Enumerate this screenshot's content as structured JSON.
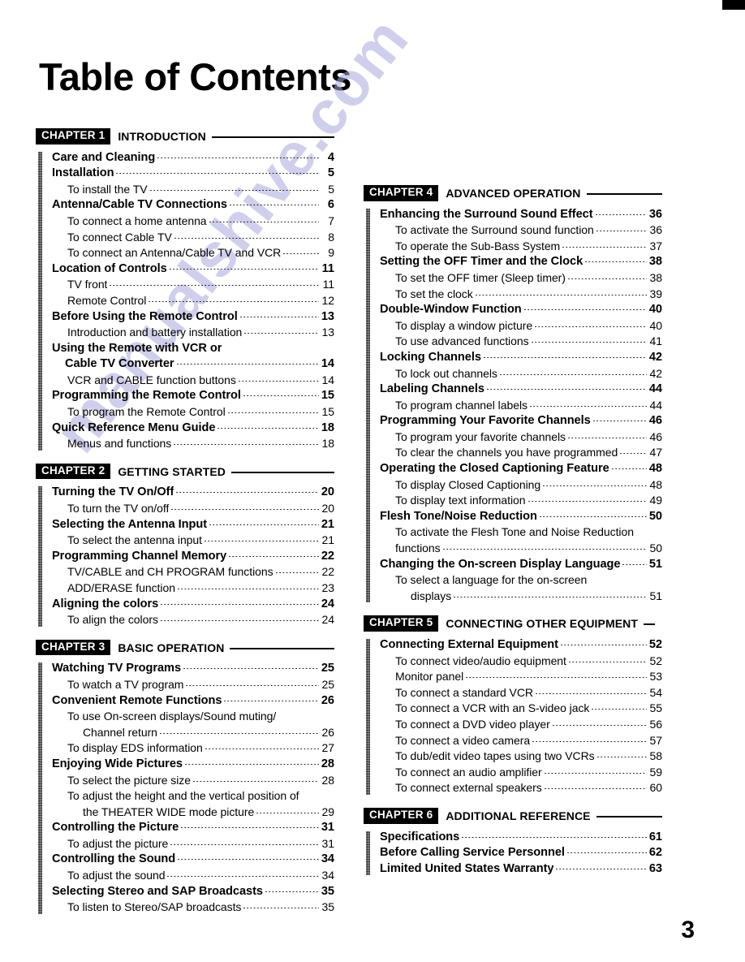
{
  "page": {
    "title": "Table of Contents",
    "folio": "3",
    "watermark": "manualshive.com",
    "accent_color": "#000000",
    "watermark_color": "#a9a8e0"
  },
  "columns": {
    "left": [
      {
        "tag": "CHAPTER 1",
        "name": "INTRODUCTION",
        "rule": "long",
        "entries": [
          {
            "level": 1,
            "label": "Care and Cleaning",
            "page": "4"
          },
          {
            "level": 1,
            "label": "Installation",
            "page": "5"
          },
          {
            "level": 2,
            "label": "To install the TV",
            "page": "5"
          },
          {
            "level": 1,
            "label": "Antenna/Cable TV Connections",
            "page": "6"
          },
          {
            "level": 2,
            "label": "To connect a home antenna",
            "page": "7"
          },
          {
            "level": 2,
            "label": "To connect Cable TV",
            "page": "8"
          },
          {
            "level": 2,
            "label": "To connect an Antenna/Cable TV and VCR",
            "page": "9"
          },
          {
            "level": 1,
            "label": "Location of Controls",
            "page": "11"
          },
          {
            "level": 2,
            "label": "TV front",
            "page": "11"
          },
          {
            "level": 2,
            "label": "Remote Control",
            "page": "12"
          },
          {
            "level": 1,
            "label": "Before Using the Remote Control",
            "page": "13"
          },
          {
            "level": 2,
            "label": "Introduction and battery installation",
            "page": "13"
          },
          {
            "level": 1,
            "label": "Using the Remote with VCR or",
            "page": "",
            "leader": false
          },
          {
            "level": 1,
            "label": "Cable TV Converter",
            "page": "14",
            "continued": true
          },
          {
            "level": 2,
            "label": "VCR and CABLE function buttons",
            "page": "14"
          },
          {
            "level": 1,
            "label": "Programming the Remote Control",
            "page": "15"
          },
          {
            "level": 2,
            "label": "To program the Remote Control",
            "page": "15"
          },
          {
            "level": 1,
            "label": "Quick Reference Menu Guide",
            "page": "18"
          },
          {
            "level": 2,
            "label": "Menus and functions",
            "page": "18"
          }
        ]
      },
      {
        "tag": "CHAPTER 2",
        "name": "GETTING STARTED",
        "rule": "long",
        "entries": [
          {
            "level": 1,
            "label": "Turning the TV On/Off",
            "page": "20"
          },
          {
            "level": 2,
            "label": "To turn the TV on/off",
            "page": "20"
          },
          {
            "level": 1,
            "label": "Selecting the Antenna Input",
            "page": "21"
          },
          {
            "level": 2,
            "label": "To select the antenna input",
            "page": "21"
          },
          {
            "level": 1,
            "label": "Programming Channel Memory",
            "page": "22"
          },
          {
            "level": 2,
            "label": "TV/CABLE and CH PROGRAM functions",
            "page": "22"
          },
          {
            "level": 2,
            "label": "ADD/ERASE function",
            "page": "23"
          },
          {
            "level": 1,
            "label": "Aligning the colors",
            "page": "24"
          },
          {
            "level": 2,
            "label": "To align the colors",
            "page": "24"
          }
        ]
      },
      {
        "tag": "CHAPTER 3",
        "name": "BASIC OPERATION",
        "rule": "long",
        "entries": [
          {
            "level": 1,
            "label": "Watching TV Programs",
            "page": "25"
          },
          {
            "level": 2,
            "label": "To watch a TV program",
            "page": "25"
          },
          {
            "level": 1,
            "label": "Convenient Remote Functions",
            "page": "26"
          },
          {
            "level": 2,
            "label": "To use On-screen displays/Sound muting/",
            "page": "",
            "leader": false
          },
          {
            "level": 2,
            "label": "Channel return",
            "page": "26",
            "continued": true
          },
          {
            "level": 2,
            "label": "To display EDS information",
            "page": "27"
          },
          {
            "level": 1,
            "label": "Enjoying Wide Pictures",
            "page": "28"
          },
          {
            "level": 2,
            "label": "To select the picture size",
            "page": "28"
          },
          {
            "level": 2,
            "label": "To adjust the height and the vertical position of",
            "page": "",
            "leader": false
          },
          {
            "level": 2,
            "label": "the THEATER WIDE mode picture",
            "page": "29",
            "continued": true
          },
          {
            "level": 1,
            "label": "Controlling the Picture",
            "page": "31"
          },
          {
            "level": 2,
            "label": "To adjust the picture",
            "page": "31"
          },
          {
            "level": 1,
            "label": "Controlling the Sound",
            "page": "34"
          },
          {
            "level": 2,
            "label": "To adjust the sound",
            "page": "34"
          },
          {
            "level": 1,
            "label": "Selecting Stereo and SAP Broadcasts",
            "page": "35"
          },
          {
            "level": 2,
            "label": "To listen to Stereo/SAP broadcasts",
            "page": "35"
          }
        ]
      }
    ],
    "right": [
      {
        "tag": "CHAPTER 4",
        "name": "ADVANCED OPERATION",
        "rule": "long",
        "entries": [
          {
            "level": 1,
            "label": "Enhancing the Surround Sound Effect",
            "page": "36"
          },
          {
            "level": 2,
            "label": "To activate the Surround sound function",
            "page": "36"
          },
          {
            "level": 2,
            "label": "To operate the Sub-Bass System",
            "page": "37"
          },
          {
            "level": 1,
            "label": "Setting the OFF Timer and the Clock",
            "page": "38"
          },
          {
            "level": 2,
            "label": "To set the OFF timer (Sleep timer)",
            "page": "38"
          },
          {
            "level": 2,
            "label": "To set the clock",
            "page": "39"
          },
          {
            "level": 1,
            "label": "Double-Window Function",
            "page": "40"
          },
          {
            "level": 2,
            "label": "To display a window picture",
            "page": "40"
          },
          {
            "level": 2,
            "label": "To use advanced functions",
            "page": "41"
          },
          {
            "level": 1,
            "label": "Locking Channels",
            "page": "42"
          },
          {
            "level": 2,
            "label": "To lock out channels",
            "page": "42"
          },
          {
            "level": 1,
            "label": "Labeling Channels",
            "page": "44"
          },
          {
            "level": 2,
            "label": "To program channel labels",
            "page": "44"
          },
          {
            "level": 1,
            "label": "Programming Your Favorite Channels",
            "page": "46"
          },
          {
            "level": 2,
            "label": "To program your favorite channels",
            "page": "46"
          },
          {
            "level": 2,
            "label": "To clear the channels you have programmed",
            "page": "47"
          },
          {
            "level": 1,
            "label": "Operating the Closed Captioning Feature",
            "page": "48"
          },
          {
            "level": 2,
            "label": "To display Closed Captioning",
            "page": "48"
          },
          {
            "level": 2,
            "label": "To display text information",
            "page": "49"
          },
          {
            "level": 1,
            "label": "Flesh Tone/Noise Reduction",
            "page": "50"
          },
          {
            "level": 2,
            "label": "To activate the Flesh Tone and Noise Reduction",
            "page": "",
            "leader": false
          },
          {
            "level": 2,
            "label": "functions",
            "page": "50",
            "continued": false
          },
          {
            "level": 1,
            "label": "Changing the On-screen Display Language",
            "page": "51"
          },
          {
            "level": 2,
            "label": "To select a language for the on-screen",
            "page": "",
            "leader": false
          },
          {
            "level": 2,
            "label": "displays",
            "page": "51",
            "continued": true
          }
        ]
      },
      {
        "tag": "CHAPTER 5",
        "name": "CONNECTING OTHER EQUIPMENT",
        "rule": "short",
        "entries": [
          {
            "level": 1,
            "label": "Connecting External Equipment",
            "page": "52"
          },
          {
            "level": 2,
            "label": "To connect video/audio equipment",
            "page": "52"
          },
          {
            "level": 2,
            "label": "Monitor panel",
            "page": "53"
          },
          {
            "level": 2,
            "label": "To connect a standard VCR",
            "page": "54"
          },
          {
            "level": 2,
            "label": "To connect a VCR with an S-video jack",
            "page": "55"
          },
          {
            "level": 2,
            "label": "To connect a DVD video player",
            "page": "56"
          },
          {
            "level": 2,
            "label": "To connect a video camera",
            "page": "57"
          },
          {
            "level": 2,
            "label": "To dub/edit video tapes using two VCRs",
            "page": "58"
          },
          {
            "level": 2,
            "label": "To connect an audio amplifier",
            "page": "59"
          },
          {
            "level": 2,
            "label": "To connect external speakers",
            "page": "60"
          }
        ]
      },
      {
        "tag": "CHAPTER 6",
        "name": "ADDITIONAL REFERENCE",
        "rule": "long",
        "entries": [
          {
            "level": 1,
            "label": "Specifications",
            "page": "61"
          },
          {
            "level": 1,
            "label": "Before Calling Service Personnel",
            "page": "62"
          },
          {
            "level": 1,
            "label": "Limited United States Warranty",
            "page": "63"
          }
        ]
      }
    ]
  }
}
